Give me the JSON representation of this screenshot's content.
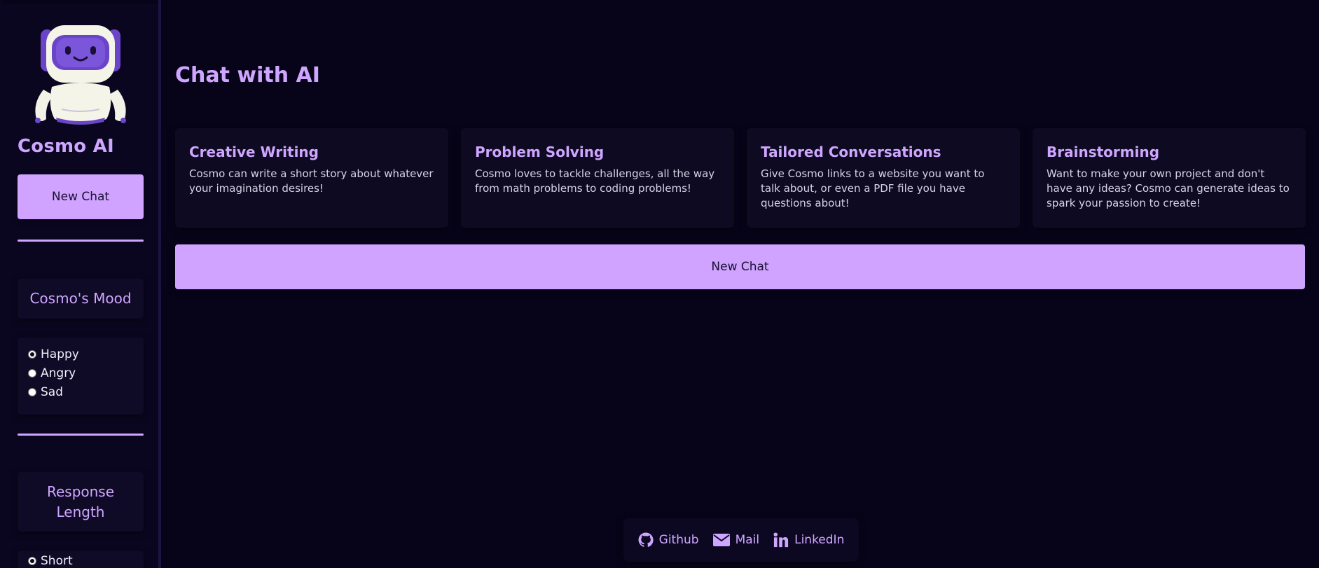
{
  "sidebar": {
    "brand": "Cosmo AI",
    "new_chat_label": "New Chat",
    "mood": {
      "title": "Cosmo's Mood",
      "options": [
        "Happy",
        "Angry",
        "Sad"
      ],
      "selected": "Happy"
    },
    "response_length": {
      "title": "Response Length",
      "options": [
        "Short"
      ],
      "selected": "Short"
    }
  },
  "main": {
    "title": "Chat with AI",
    "cards": [
      {
        "title": "Creative Writing",
        "description": "Cosmo can write a short story about whatever your imagination desires!"
      },
      {
        "title": "Problem Solving",
        "description": "Cosmo loves to tackle challenges, all the way from math problems to coding problems!"
      },
      {
        "title": "Tailored Conversations",
        "description": "Give Cosmo links to a website you want to talk about, or even a PDF file you have questions about!"
      },
      {
        "title": "Brainstorming",
        "description": "Want to make your own project and don't have any ideas? Cosmo can generate ideas to spark your passion to create!"
      }
    ],
    "new_chat_label": "New Chat"
  },
  "footer": {
    "links": [
      {
        "label": "Github",
        "icon": "github-icon"
      },
      {
        "label": "Mail",
        "icon": "mail-icon"
      },
      {
        "label": "LinkedIn",
        "icon": "linkedin-icon"
      }
    ]
  },
  "colors": {
    "background": "#07041a",
    "accent": "#cfa6ff",
    "button": "#cfa3ff",
    "card": "#0e0a22"
  }
}
